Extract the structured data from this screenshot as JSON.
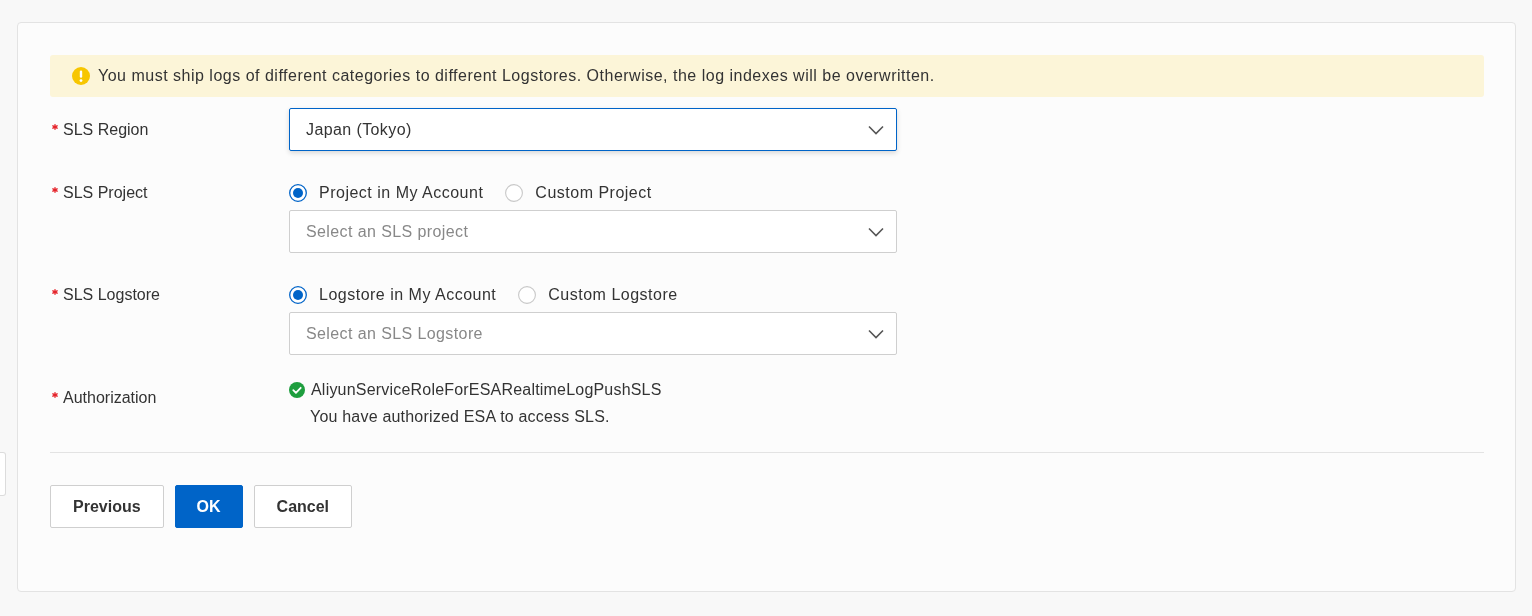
{
  "alert": {
    "text": "You must ship logs of different categories to different Logstores. Otherwise, the log indexes will be overwritten."
  },
  "fields": [
    {
      "kind": "select",
      "label": "SLS Region",
      "required": true,
      "select": {
        "value": "Japan (Tokyo)",
        "focused": true
      }
    },
    {
      "kind": "radio_select",
      "label": "SLS Project",
      "required": true,
      "options": [
        {
          "label": "Project in My Account",
          "selected": true
        },
        {
          "label": "Custom Project",
          "selected": false
        }
      ],
      "select": {
        "placeholder": "Select an SLS project",
        "focused": false
      }
    },
    {
      "kind": "radio_select",
      "label": "SLS Logstore",
      "required": true,
      "options": [
        {
          "label": "Logstore in My Account",
          "selected": true
        },
        {
          "label": "Custom Logstore",
          "selected": false
        }
      ],
      "select": {
        "placeholder": "Select an SLS Logstore",
        "focused": false
      }
    },
    {
      "kind": "status",
      "label": "Authorization",
      "required": true,
      "authorized": true,
      "role": "AliyunServiceRoleForESARealtimeLogPushSLS",
      "note": "You have authorized ESA to access SLS."
    }
  ],
  "buttons": [
    {
      "label": "Previous",
      "primary": false
    },
    {
      "label": "OK",
      "primary": true
    },
    {
      "label": "Cancel",
      "primary": false
    }
  ]
}
